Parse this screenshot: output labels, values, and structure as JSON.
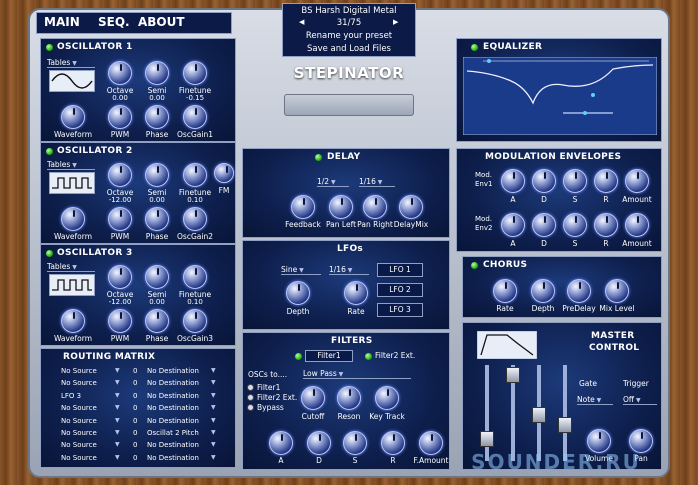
{
  "nav": {
    "main": "MAIN",
    "seq": "SEQ.",
    "about": "ABOUT"
  },
  "preset": {
    "name": "BS Harsh Digital Metal",
    "index": "31/75",
    "rename": "Rename your preset",
    "saveload": "Save and Load Files"
  },
  "logo": "STEPINATOR",
  "osc1": {
    "title": "OSCILLATOR 1",
    "table": "Tables",
    "knobs": [
      {
        "label": "Octave",
        "value": "0.00"
      },
      {
        "label": "Semi",
        "value": "0.00"
      },
      {
        "label": "Finetune",
        "value": "-0.15"
      }
    ],
    "knobs2": [
      "Waveform",
      "PWM",
      "Phase",
      "OscGain1"
    ]
  },
  "osc2": {
    "title": "OSCILLATOR 2",
    "table": "Tables",
    "knobs": [
      {
        "label": "Octave",
        "value": "-12.00"
      },
      {
        "label": "Semi",
        "value": "0.00"
      },
      {
        "label": "Finetune",
        "value": "0.10"
      },
      {
        "label": "FM",
        "value": ""
      }
    ],
    "knobs2": [
      "Waveform",
      "PWM",
      "Phase",
      "OscGain2"
    ]
  },
  "osc3": {
    "title": "OSCILLATOR 3",
    "table": "Tables",
    "knobs": [
      {
        "label": "Octave",
        "value": "-12.00"
      },
      {
        "label": "Semi",
        "value": "0.00"
      },
      {
        "label": "Finetune",
        "value": "0.10"
      }
    ],
    "knobs2": [
      "Waveform",
      "PWM",
      "Phase",
      "OscGain3"
    ]
  },
  "routing": {
    "title": "ROUTING MATRIX",
    "rows": [
      {
        "src": "No Source",
        "amt": "0",
        "dst": "No Destination"
      },
      {
        "src": "No Source",
        "amt": "0",
        "dst": "No Destination"
      },
      {
        "src": "LFO 3",
        "amt": "0",
        "dst": "No Destination"
      },
      {
        "src": "No Source",
        "amt": "0",
        "dst": "No Destination"
      },
      {
        "src": "No Source",
        "amt": "0",
        "dst": "No Destination"
      },
      {
        "src": "No Source",
        "amt": "0",
        "dst": "Oscillat 2 Pitch"
      },
      {
        "src": "No Source",
        "amt": "0",
        "dst": "No Destination"
      },
      {
        "src": "No Source",
        "amt": "0",
        "dst": "No Destination"
      }
    ]
  },
  "delay": {
    "title": "DELAY",
    "sel1": "1/2",
    "sel2": "1/16",
    "knobs": [
      "Feedback",
      "Pan Left",
      "Pan Right",
      "DelayMix"
    ]
  },
  "lfo": {
    "title": "LFOs",
    "shape": "Sine",
    "rate_sel": "1/16",
    "knobs": [
      "Depth",
      "Rate"
    ],
    "lfos": [
      "LFO 1",
      "LFO 2",
      "LFO 3"
    ]
  },
  "filters": {
    "title": "FILTERS",
    "f1": "Filter1",
    "f2": "Filter2 Ext.",
    "oscsto": "OSCs to....",
    "type": "Low Pass",
    "routes": [
      "Filter1",
      "Filter2 Ext.",
      "Bypass"
    ],
    "knobs": [
      "Cutoff",
      "Reson",
      "Key Track"
    ],
    "adsr": [
      "A",
      "D",
      "S",
      "R",
      "F.Amount"
    ]
  },
  "eq": {
    "title": "EQUALIZER"
  },
  "modenv": {
    "title": "MODULATION ENVELOPES",
    "env1": "Mod. Env1",
    "env2": "Mod. Env2",
    "knobs": [
      "A",
      "D",
      "S",
      "R",
      "Amount"
    ]
  },
  "chorus": {
    "title": "CHORUS",
    "knobs": [
      "Rate",
      "Depth",
      "PreDelay",
      "Mix Level"
    ]
  },
  "master": {
    "title1": "MASTER",
    "title2": "CONTROL",
    "gate": "Gate",
    "trigger": "Trigger",
    "gate_val": "Note",
    "trigger_val": "Off",
    "volume": "Volume",
    "pan": "Pan"
  },
  "watermark": "SOUNDER.RU"
}
